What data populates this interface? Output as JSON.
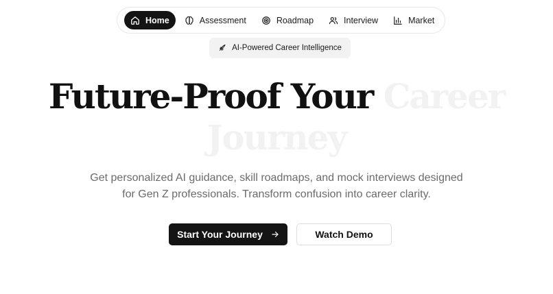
{
  "nav": {
    "items": [
      {
        "label": "Home",
        "icon": "home-icon",
        "active": true
      },
      {
        "label": "Assessment",
        "icon": "brain-icon"
      },
      {
        "label": "Roadmap",
        "icon": "target-icon"
      },
      {
        "label": "Interview",
        "icon": "users-icon"
      },
      {
        "label": "Market",
        "icon": "bar-chart-icon"
      }
    ]
  },
  "badge": {
    "label": "AI-Powered Career Intelligence",
    "icon": "rocket-icon"
  },
  "hero": {
    "title_dark": "Future-Proof Your",
    "title_faint_1": "Career",
    "title_faint_2": "Journey"
  },
  "subtitle": {
    "line1": "Get personalized AI guidance, skill roadmaps, and mock interviews designed",
    "line2": "for Gen Z professionals. Transform confusion into career clarity."
  },
  "buttons": {
    "primary": "Start Your Journey",
    "primary_icon": "arrow-right-icon",
    "secondary": "Watch Demo"
  },
  "colors": {
    "primary": "#141414",
    "text_muted": "#6b6b6b",
    "faint_text": "#f2f2f2",
    "badge_bg": "#f2f2f2"
  }
}
